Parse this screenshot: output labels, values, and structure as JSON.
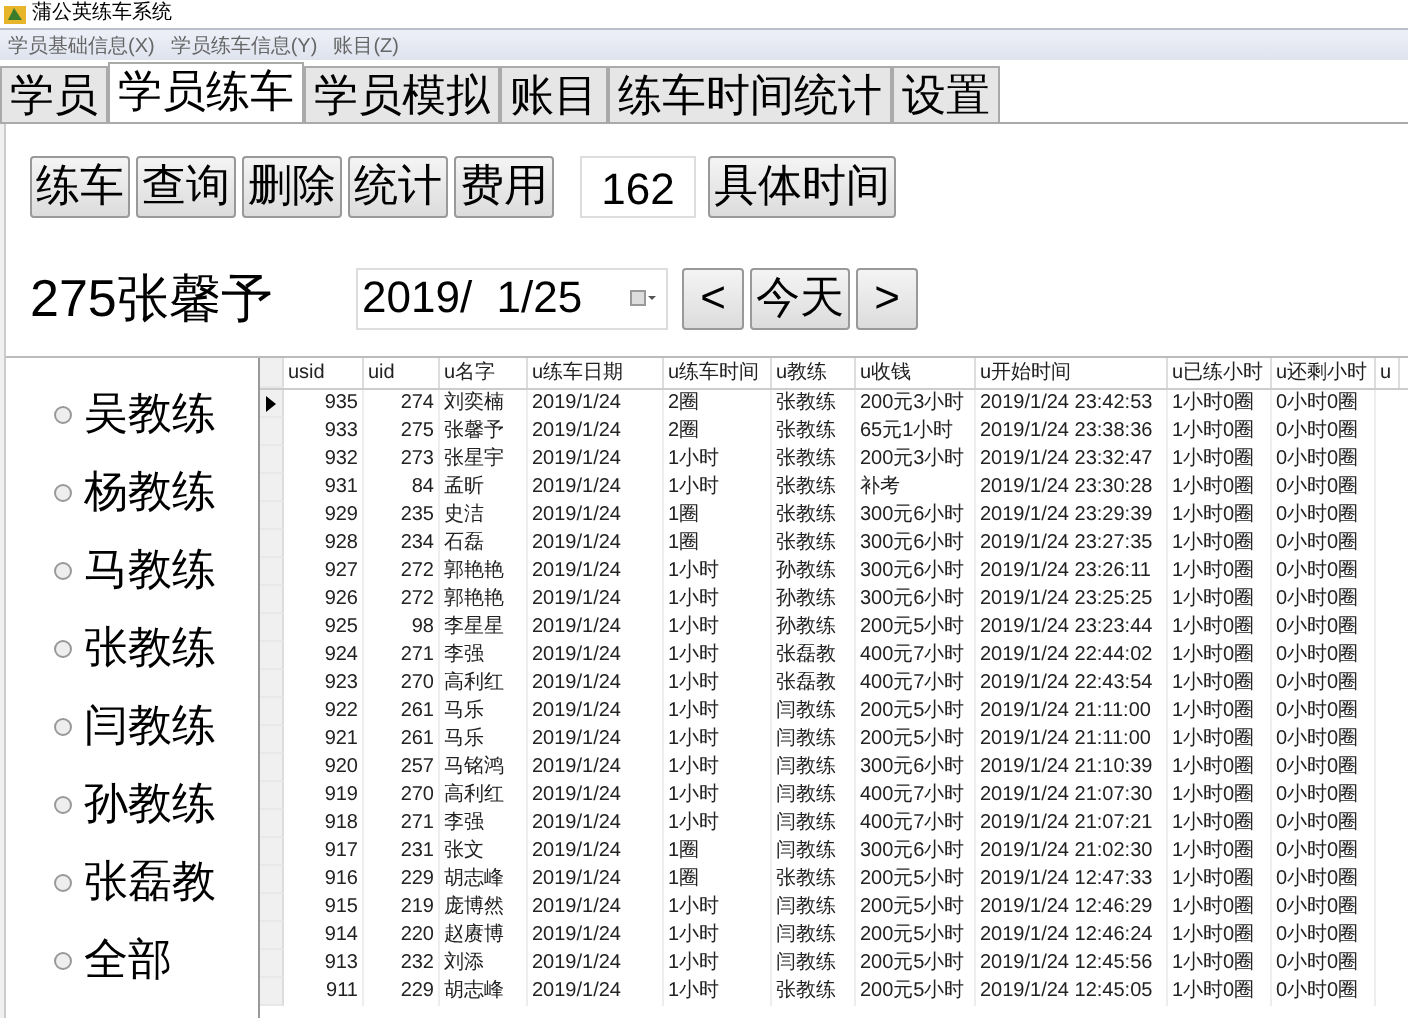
{
  "window": {
    "title": "蒲公英练车系统"
  },
  "menu": [
    "学员基础信息(X)",
    "学员练车信息(Y)",
    "账目(Z)"
  ],
  "tabs": [
    {
      "label": "学员",
      "selected": false
    },
    {
      "label": "学员练车",
      "selected": true
    },
    {
      "label": "学员模拟",
      "selected": false
    },
    {
      "label": "账目",
      "selected": false
    },
    {
      "label": "练车时间统计",
      "selected": false
    },
    {
      "label": "设置",
      "selected": false
    }
  ],
  "toolbar": {
    "buttons": [
      "练车",
      "查询",
      "删除",
      "统计",
      "费用"
    ],
    "count": "162",
    "detail_button": "具体时间"
  },
  "student": "275张馨予",
  "date_picker": {
    "value": "2019/  1/25"
  },
  "date_buttons": [
    "<",
    "今天",
    ">"
  ],
  "coaches": [
    {
      "label": "吴教练",
      "selected": false
    },
    {
      "label": "杨教练",
      "selected": false
    },
    {
      "label": "马教练",
      "selected": false
    },
    {
      "label": "张教练",
      "selected": false
    },
    {
      "label": "闫教练",
      "selected": false
    },
    {
      "label": "孙教练",
      "selected": false
    },
    {
      "label": "张磊教",
      "selected": false
    },
    {
      "label": "全部",
      "selected": false
    }
  ],
  "table": {
    "columns": [
      "usid",
      "uid",
      "u名字",
      "u练车日期",
      "u练车时间",
      "u教练",
      "u收钱",
      "u开始时间",
      "u已练小时",
      "u还剩小时",
      "u"
    ],
    "rows": [
      {
        "selected": true,
        "cells": [
          "935",
          "274",
          "刘奕楠",
          "2019/1/24",
          "2圈",
          "张教练",
          "200元3小时",
          "2019/1/24 23:42:53",
          "1小时0圈",
          "0小时0圈"
        ]
      },
      {
        "selected": false,
        "cells": [
          "933",
          "275",
          "张馨予",
          "2019/1/24",
          "2圈",
          "张教练",
          "65元1小时",
          "2019/1/24 23:38:36",
          "1小时0圈",
          "0小时0圈"
        ]
      },
      {
        "selected": false,
        "cells": [
          "932",
          "273",
          "张星宇",
          "2019/1/24",
          "1小时",
          "张教练",
          "200元3小时",
          "2019/1/24 23:32:47",
          "1小时0圈",
          "0小时0圈"
        ]
      },
      {
        "selected": false,
        "cells": [
          "931",
          "84",
          "孟昕",
          "2019/1/24",
          "1小时",
          "张教练",
          "补考",
          "2019/1/24 23:30:28",
          "1小时0圈",
          "0小时0圈"
        ]
      },
      {
        "selected": false,
        "cells": [
          "929",
          "235",
          "史洁",
          "2019/1/24",
          "1圈",
          "张教练",
          "300元6小时",
          "2019/1/24 23:29:39",
          "1小时0圈",
          "0小时0圈"
        ]
      },
      {
        "selected": false,
        "cells": [
          "928",
          "234",
          "石磊",
          "2019/1/24",
          "1圈",
          "张教练",
          "300元6小时",
          "2019/1/24 23:27:35",
          "1小时0圈",
          "0小时0圈"
        ]
      },
      {
        "selected": false,
        "cells": [
          "927",
          "272",
          "郭艳艳",
          "2019/1/24",
          "1小时",
          "孙教练",
          "300元6小时",
          "2019/1/24 23:26:11",
          "1小时0圈",
          "0小时0圈"
        ]
      },
      {
        "selected": false,
        "cells": [
          "926",
          "272",
          "郭艳艳",
          "2019/1/24",
          "1小时",
          "孙教练",
          "300元6小时",
          "2019/1/24 23:25:25",
          "1小时0圈",
          "0小时0圈"
        ]
      },
      {
        "selected": false,
        "cells": [
          "925",
          "98",
          "李星星",
          "2019/1/24",
          "1小时",
          "孙教练",
          "200元5小时",
          "2019/1/24 23:23:44",
          "1小时0圈",
          "0小时0圈"
        ]
      },
      {
        "selected": false,
        "cells": [
          "924",
          "271",
          "李强",
          "2019/1/24",
          "1小时",
          "张磊教",
          "400元7小时",
          "2019/1/24 22:44:02",
          "1小时0圈",
          "0小时0圈"
        ]
      },
      {
        "selected": false,
        "cells": [
          "923",
          "270",
          "高利红",
          "2019/1/24",
          "1小时",
          "张磊教",
          "400元7小时",
          "2019/1/24 22:43:54",
          "1小时0圈",
          "0小时0圈"
        ]
      },
      {
        "selected": false,
        "cells": [
          "922",
          "261",
          "马乐",
          "2019/1/24",
          "1小时",
          "闫教练",
          "200元5小时",
          "2019/1/24 21:11:00",
          "1小时0圈",
          "0小时0圈"
        ]
      },
      {
        "selected": false,
        "cells": [
          "921",
          "261",
          "马乐",
          "2019/1/24",
          "1小时",
          "闫教练",
          "200元5小时",
          "2019/1/24 21:11:00",
          "1小时0圈",
          "0小时0圈"
        ]
      },
      {
        "selected": false,
        "cells": [
          "920",
          "257",
          "马铭鸿",
          "2019/1/24",
          "1小时",
          "闫教练",
          "300元6小时",
          "2019/1/24 21:10:39",
          "1小时0圈",
          "0小时0圈"
        ]
      },
      {
        "selected": false,
        "cells": [
          "919",
          "270",
          "高利红",
          "2019/1/24",
          "1小时",
          "闫教练",
          "400元7小时",
          "2019/1/24 21:07:30",
          "1小时0圈",
          "0小时0圈"
        ]
      },
      {
        "selected": false,
        "cells": [
          "918",
          "271",
          "李强",
          "2019/1/24",
          "1小时",
          "闫教练",
          "400元7小时",
          "2019/1/24 21:07:21",
          "1小时0圈",
          "0小时0圈"
        ]
      },
      {
        "selected": false,
        "cells": [
          "917",
          "231",
          "张文",
          "2019/1/24",
          "1圈",
          "闫教练",
          "300元6小时",
          "2019/1/24 21:02:30",
          "1小时0圈",
          "0小时0圈"
        ]
      },
      {
        "selected": false,
        "cells": [
          "916",
          "229",
          "胡志峰",
          "2019/1/24",
          "1圈",
          "张教练",
          "200元5小时",
          "2019/1/24 12:47:33",
          "1小时0圈",
          "0小时0圈"
        ]
      },
      {
        "selected": false,
        "cells": [
          "915",
          "219",
          "庞博然",
          "2019/1/24",
          "1小时",
          "闫教练",
          "200元5小时",
          "2019/1/24 12:46:29",
          "1小时0圈",
          "0小时0圈"
        ]
      },
      {
        "selected": false,
        "cells": [
          "914",
          "220",
          "赵赓博",
          "2019/1/24",
          "1小时",
          "闫教练",
          "200元5小时",
          "2019/1/24 12:46:24",
          "1小时0圈",
          "0小时0圈"
        ]
      },
      {
        "selected": false,
        "cells": [
          "913",
          "232",
          "刘添",
          "2019/1/24",
          "1小时",
          "闫教练",
          "200元5小时",
          "2019/1/24 12:45:56",
          "1小时0圈",
          "0小时0圈"
        ]
      },
      {
        "selected": false,
        "cells": [
          "911",
          "229",
          "胡志峰",
          "2019/1/24",
          "1小时",
          "张教练",
          "200元5小时",
          "2019/1/24 12:45:05",
          "1小时0圈",
          "0小时0圈"
        ]
      }
    ]
  }
}
